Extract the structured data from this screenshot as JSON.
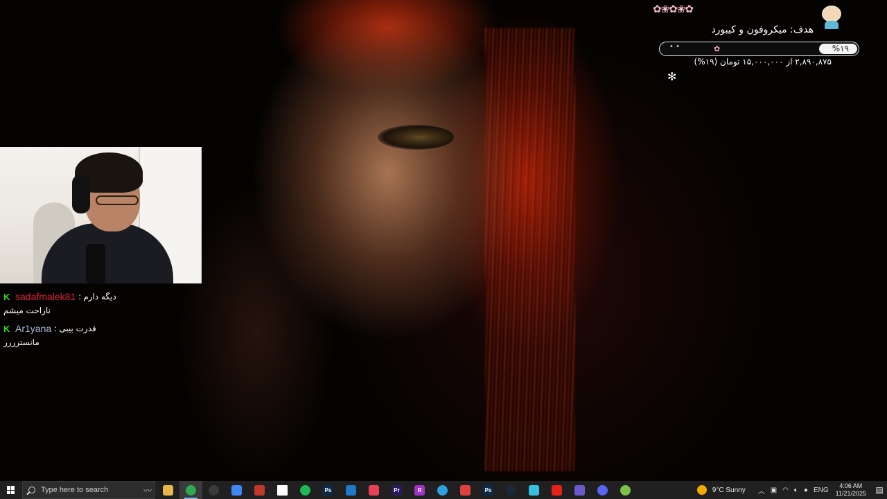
{
  "goal": {
    "title": "هدف: میکروفون و کیبورد",
    "percent_label": "%۱۹",
    "percent": 19,
    "amount_text": "۲,۸۹۰,۸۷۵ از ۱۵,۰۰۰,۰۰۰ تومان (۱۹%)",
    "decor_flowers": "✿❀✿❀✿",
    "decor_petal": "✿",
    "decor_dots": "• •",
    "decor_star": "✻"
  },
  "chat": {
    "messages": [
      {
        "badge": "K",
        "user": "sadafmalek81",
        "user_color": "#e0203a",
        "sep": ":",
        "text": "دیگه دارم",
        "text2": "ناراحت میشم"
      },
      {
        "badge": "K",
        "user": "Ar1yana",
        "user_color": "#a9b9d6",
        "sep": ":",
        "text": "قدرت بیبی",
        "text2": "مانسترررر"
      }
    ]
  },
  "taskbar": {
    "search_placeholder": "Type here to search",
    "apps": [
      {
        "name": "file-explorer",
        "label": "",
        "color": "#e8b74a"
      },
      {
        "name": "chrome",
        "label": "",
        "color": "#2fa84f"
      },
      {
        "name": "obs",
        "label": "",
        "color": "#3a3a3a"
      },
      {
        "name": "google-drive",
        "label": "",
        "color": "#4285f4"
      },
      {
        "name": "winrar",
        "label": "",
        "color": "#c0392b"
      },
      {
        "name": "notepad",
        "label": "",
        "color": "#ffffff"
      },
      {
        "name": "spotify",
        "label": "",
        "color": "#1db954"
      },
      {
        "name": "photoshop",
        "label": "Ps",
        "color": "#0b2a4a"
      },
      {
        "name": "vscode",
        "label": "",
        "color": "#1e7ac8"
      },
      {
        "name": "valorant",
        "label": "",
        "color": "#e84057"
      },
      {
        "name": "premiere",
        "label": "Pr",
        "color": "#2a1a5e"
      },
      {
        "name": "rider",
        "label": "R",
        "color": "#a233c7"
      },
      {
        "name": "telegram",
        "label": "",
        "color": "#2aa3e0"
      },
      {
        "name": "mic-app",
        "label": "",
        "color": "#e04040"
      },
      {
        "name": "photoshop-2",
        "label": "Ps",
        "color": "#0b2a4a"
      },
      {
        "name": "steam",
        "label": "",
        "color": "#1b2838"
      },
      {
        "name": "settings-app",
        "label": "",
        "color": "#34c0e0"
      },
      {
        "name": "youtube",
        "label": "",
        "color": "#e62117"
      },
      {
        "name": "game-app",
        "label": "",
        "color": "#6a5acd"
      },
      {
        "name": "discord",
        "label": "",
        "color": "#5865f2"
      },
      {
        "name": "other-app",
        "label": "",
        "color": "#7cc24a"
      }
    ],
    "weather": "9°C  Sunny",
    "lang": "ENG",
    "time": "4:06 AM",
    "date": "11/21/2025"
  }
}
